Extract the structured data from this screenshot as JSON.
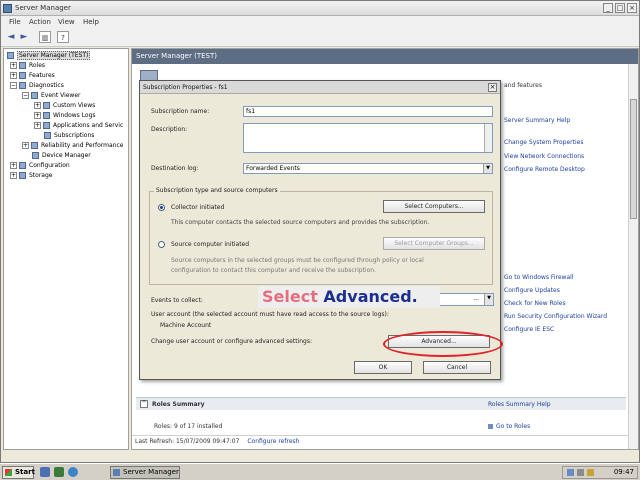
{
  "window": {
    "title": "Server Manager",
    "menu": [
      "File",
      "Action",
      "View",
      "Help"
    ],
    "controls": {
      "minimize": "_",
      "maximize": "□",
      "close": "×"
    }
  },
  "toolbar": {
    "back": "◄",
    "forward": "►",
    "view": "▥",
    "help": "?"
  },
  "tree": {
    "root": "Server Manager (TEST)",
    "items": [
      "Roles",
      "Features",
      "Diagnostics",
      "Event Viewer",
      "Custom Views",
      "Windows Logs",
      "Applications and Servic",
      "Subscriptions",
      "Reliability and Performance",
      "Device Manager",
      "Configuration",
      "Storage"
    ]
  },
  "content": {
    "header": "Server Manager (TEST)",
    "right_fragment": "and features",
    "links_top": [
      "Server Summary Help",
      "Change System Properties",
      "View Network Connections",
      "Configure Remote Desktop"
    ],
    "links_bottom": [
      "Go to Windows Firewall",
      "Configure Updates",
      "Check for New Roles",
      "Run Security Configuration Wizard",
      "Configure IE ESC"
    ],
    "roles_section": "Roles Summary",
    "roles_help": "Roles Summary Help",
    "roles_count": "Roles: 9 of 17 installed",
    "go_to_roles": "Go to Roles",
    "last_refresh": "Last Refresh: 15/07/2009 09:47:07",
    "configure_refresh": "Configure refresh"
  },
  "dialog": {
    "title": "Subscription Properties - fs1",
    "close": "×",
    "sub_name_label": "Subscription name:",
    "sub_name_value": "fs1",
    "description_label": "Description:",
    "description_value": "",
    "dest_log_label": "Destination log:",
    "dest_log_value": "Forwarded Events",
    "group_title": "Subscription type and source computers",
    "collector_label": "Collector initiated",
    "collector_selected": true,
    "select_computers_btn": "Select Computers...",
    "collector_desc": "This computer contacts the selected source computers and provides the subscription.",
    "source_label": "Source computer initiated",
    "source_selected": false,
    "select_groups_btn": "Select Computer Groups...",
    "source_desc_1": "Source computers in the selected groups must be configured through policy or local",
    "source_desc_2": "configuration to contact this computer and receive the subscription.",
    "events_label": "Events to collect:",
    "events_value": "...",
    "user_account_text": "User account (the selected account must have read access to the source logs):",
    "user_account_value": "Machine Account",
    "advanced_text": "Change user account or configure advanced settings:",
    "advanced_btn": "Advanced...",
    "ok_btn": "OK",
    "cancel_btn": "Cancel"
  },
  "annotation": {
    "part1": "Select",
    "part2": "Advanced."
  },
  "taskbar": {
    "start": "Start",
    "task": "Server Manager",
    "clock": "09:47"
  },
  "colors": {
    "header": "#5d6d84",
    "link": "#1b3f9c",
    "highlight": "#e0222b",
    "callout_red": "#e46f7f",
    "callout_blue": "#1c2f8f"
  }
}
